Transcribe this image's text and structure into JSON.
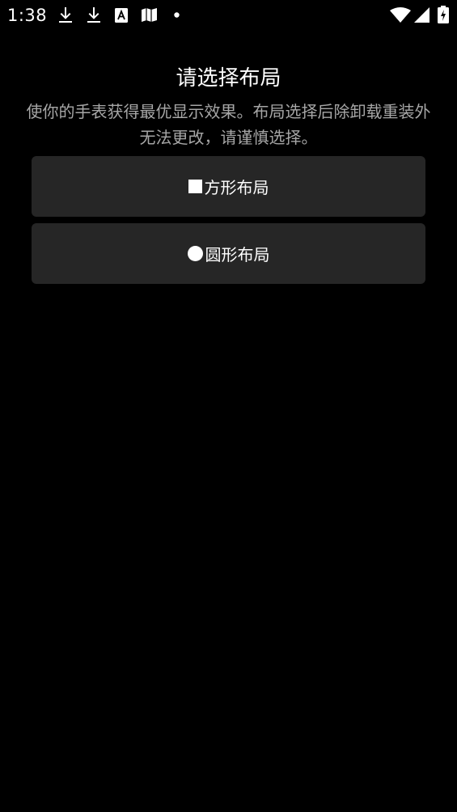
{
  "status_bar": {
    "time": "1:38",
    "left_icons": [
      "download-icon",
      "download-icon",
      "accessibility-icon",
      "map-icon",
      "notification-dot-icon"
    ],
    "right_icons": [
      "wifi-icon",
      "signal-icon",
      "battery-charging-icon"
    ]
  },
  "layout_picker": {
    "title": "请选择布局",
    "description": "使你的手表获得最优显示效果。布局选择后除卸载重装外无法更改，请谨慎选择。",
    "options": [
      {
        "shape_icon": "square-shape-icon",
        "label": "方形布局"
      },
      {
        "shape_icon": "circle-shape-icon",
        "label": "圆形布局"
      }
    ]
  },
  "colors": {
    "background": "#000000",
    "option_background": "#262626",
    "text_primary": "#ffffff",
    "text_secondary": "#a6a6a6"
  }
}
